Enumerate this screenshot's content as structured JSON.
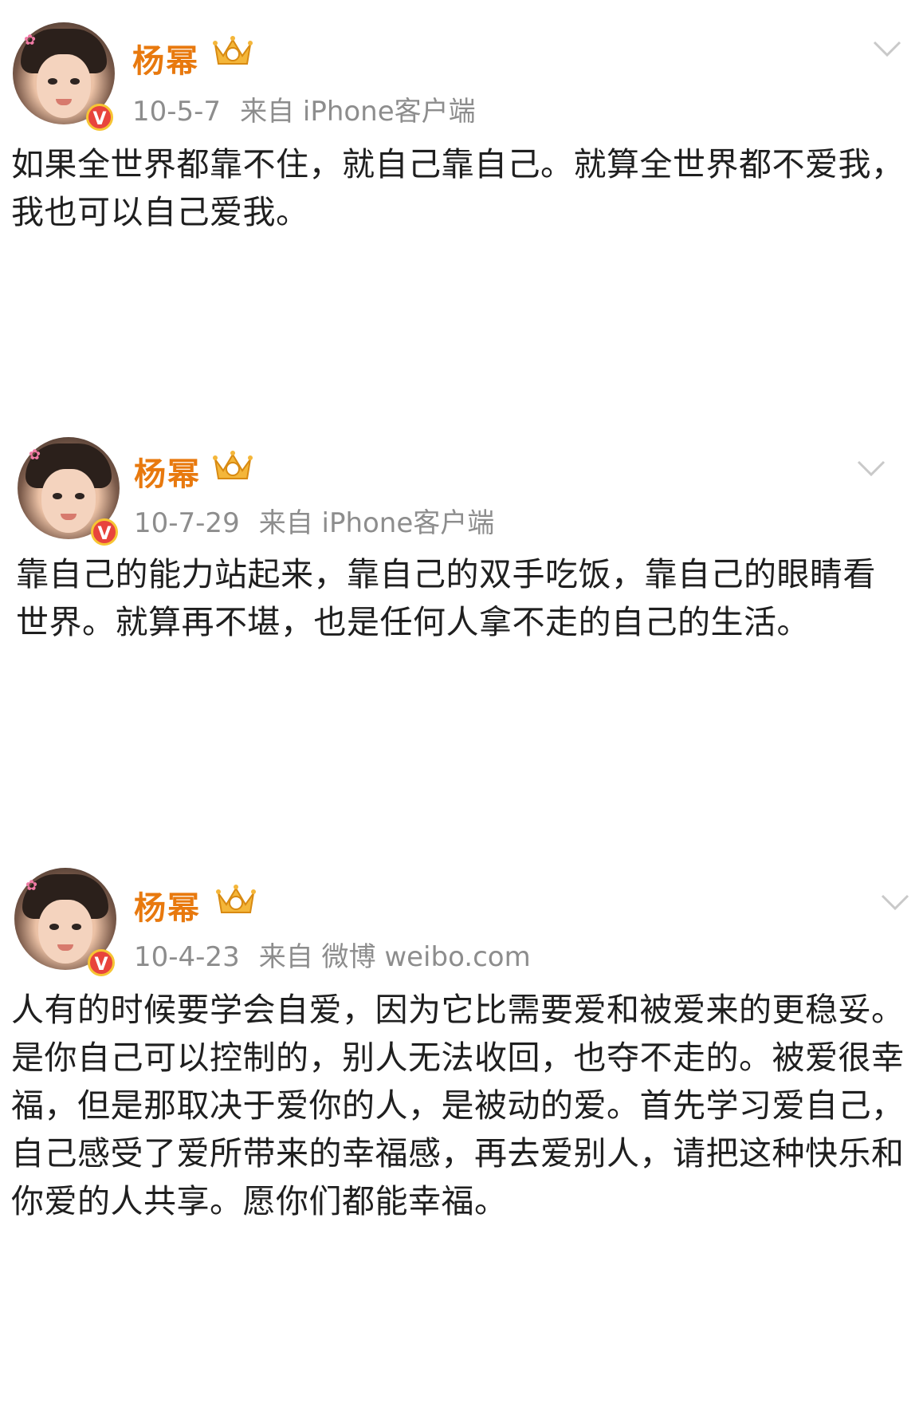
{
  "posts": [
    {
      "author": "杨幂",
      "date": "10-5-7",
      "source": "来自 iPhone客户端",
      "text": "如果全世界都靠不住，就自己靠自己。就算全世界都不爱我，我也可以自己爱我。",
      "badge": "V"
    },
    {
      "author": "杨幂",
      "date": "10-7-29",
      "source": "来自 iPhone客户端",
      "text": "靠自己的能力站起来，靠自己的双手吃饭，靠自己的眼睛看世界。就算再不堪，也是任何人拿不走的自己的生活。",
      "badge": "V"
    },
    {
      "author": "杨幂",
      "date": "10-4-23",
      "source": "来自 微博 weibo.com",
      "text": "人有的时候要学会自爱，因为它比需要爱和被爱来的更稳妥。是你自己可以控制的，别人无法收回，也夺不走的。被爱很幸福，但是那取决于爱你的人，是被动的爱。首先学习爱自己，自己感受了爱所带来的幸福感，再去爱别人，请把这种快乐和你爱的人共享。愿你们都能幸福。",
      "badge": "V"
    }
  ],
  "colors": {
    "name": "#e8790e",
    "meta": "#8d8d8d",
    "body": "#1f1f1f",
    "verified": "#e8443c"
  },
  "icons": {
    "crown": "vip-crown-icon",
    "chevron": "chevron-down-icon",
    "verified": "verified-badge-icon"
  }
}
